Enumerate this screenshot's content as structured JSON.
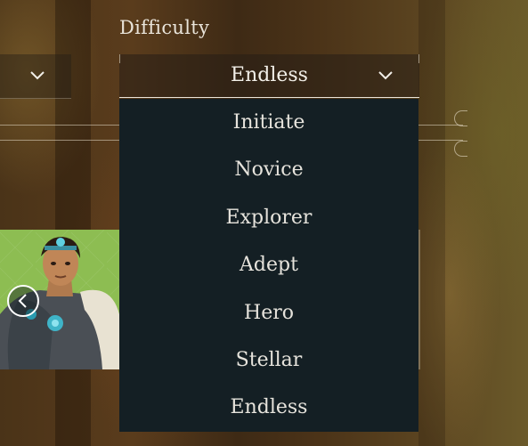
{
  "difficulty": {
    "label": "Difficulty",
    "selected": "Endless",
    "options": [
      "Initiate",
      "Novice",
      "Explorer",
      "Adept",
      "Hero",
      "Stellar",
      "Endless"
    ]
  },
  "icons": {
    "dropdown": "chevron-down-icon",
    "prev": "chevron-left-icon"
  },
  "colors": {
    "menu_bg": "#141f24",
    "text": "#e6e3dc",
    "portrait_bg": "#8dbd52"
  }
}
